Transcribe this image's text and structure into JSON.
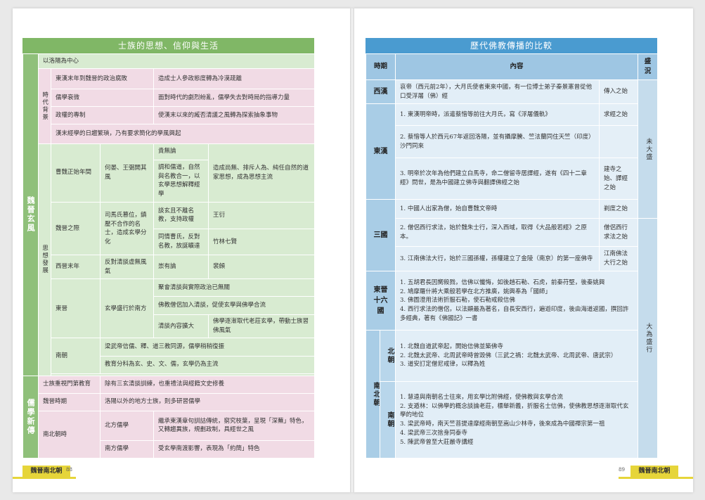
{
  "left": {
    "title": "士族的思想、信仰與生活",
    "side_a": "魏晉玄風",
    "side_b": "儒學新傳",
    "intro": "以洛陽為中心",
    "bg_label": "時代背景",
    "bg_rows": [
      {
        "k": "東漢末年到魏晉的政治腐敗",
        "v": "造成士人參政態度轉為冷漠疏離"
      },
      {
        "k": "儒學衰微",
        "v": "面對時代的劇烈紛亂，儒學失去對時局的指導力量"
      },
      {
        "k": "政權的專制",
        "v": "使漢末以來的臧否清議之風轉為探索抽象事物"
      }
    ],
    "bg_note": "漢末經學的日趨繁瑣，乃有要求簡化的學風興起",
    "dev_label": "思想發展",
    "caowei_period": "曹魏正始年間",
    "caowei_people": "何晏、王弼開其風",
    "caowei_a": "貴無論",
    "caowei_b": "調和儒道，自然與名教合一，以玄學思想解釋經學",
    "caowei_result": "造成尚無、排斥人為、純任自然的道家思想，成為思想主流",
    "weijin_period": "魏晉之際",
    "weijin_people": "司馬氏篡位，鎮壓不合作的名士，造成玄學分化",
    "weijin_a": "談玄且不離名教，支持政權",
    "weijin_a_who": "王衍",
    "weijin_b": "同情曹氏，反對名教，放誕曠達",
    "weijin_b_who": "竹林七賢",
    "xijin_period": "西晉末年",
    "xijin_people": "反對清談虛無風氣",
    "xijin_a": "崇有論",
    "xijin_a_who": "裴頠",
    "dongjin_period": "東晉",
    "dongjin_people": "玄學盛行於南方",
    "dongjin_a": "聚會清談與實際政治已無關",
    "dongjin_b": "佛教僧侶加入清談，促使玄學與佛學合流",
    "dongjin_c": "清談內容擴大",
    "dongjin_c_result": "佛學逐漸取代老莊玄學，帶動士族習佛風氣",
    "nanchao_period": "南朝",
    "nanchao_a": "梁武帝信儒、釋、道三教同源，儒學稍稍復振",
    "nanchao_b": "教育分科為玄、史、文、儒，玄學仍為主流",
    "rx_1k": "士族重視門第教育",
    "rx_1v": "除有三玄清談訓練，也重禮法與經籍文史修養",
    "rx_2k": "魏晉時期",
    "rx_2v": "洛陽以外的地方士族，則多研習儒學",
    "rx_3k": "南北朝時",
    "rx_3a": "北方儒學",
    "rx_3a_v": "繼承東漢章句訓詁傳統，窮究枝葉，呈現「深蕪」特色，又轉趨異族，規劃政制，具經世之風",
    "rx_3b": "南方儒學",
    "rx_3b_v": "受玄學南渡影響，表現為「約簡」特色"
  },
  "right": {
    "title": "歷代佛教傳播的比較",
    "head": {
      "period": "時期",
      "content": "內容",
      "status": "盛況"
    },
    "xihan": {
      "name": "西漢",
      "text": "哀帝（西元前2年），大月氏使者東來中國，有一位博士弟子秦景憲曾從他口受浮屠（佛）經",
      "note": "傳入之始"
    },
    "donghan": {
      "name": "東漢",
      "rows": [
        {
          "text": "1. 東漢明帝時，派遣蔡愔等前往大月氏，寫《浮屠儀軌》",
          "note": "求經之始"
        },
        {
          "text": "2. 蔡愔等人於西元67年返回洛陽，並有攝摩騰、竺法蘭同住天竺（印度）沙門同來",
          "note": ""
        },
        {
          "text": "3. 明帝於次年為他們建立白馬寺，命二僧留寺居譯經，遂有《四十二章經》問世，是為中國建立佛寺與翻譯佛經之始",
          "note": "建寺之始、譯經之始"
        }
      ]
    },
    "sanguo": {
      "name": "三國",
      "rows": [
        {
          "text": "1. 中國人出家為僧，始自曹魏文帝時",
          "note": "剃度之始"
        },
        {
          "text": "2. 僧侶西行求法，始於魏朱士行，深入西域，取得《大品般若經》之原本。",
          "note": "僧侶西行求法之始"
        },
        {
          "text": "3. 江南佛法大行，始於三國孫權，孫權建立了金陵（南京）的第一座佛寺",
          "note": "江南佛法大行之始"
        }
      ]
    },
    "dongjin": {
      "name_a": "東晉",
      "name_b": "十六國",
      "lines": [
        "1. 五胡君長因嚮殺戮，信佛以懺悔，如後趙石勒、石虎，前秦苻堅，後秦姚興",
        "2. 鳩摩羅什將大乘般若學在北方推廣，姚興奉為「國師」",
        "3. 佛圖澄用法術折服石勒，使石勒戒殺信佛",
        "4. 西行求法的僧侶，以法顯最為著名，自長安西行，遍遊印度，後由海道返國，撰回許多經典，著有《佛國記》一書"
      ]
    },
    "nanbei": {
      "name": "南北朝",
      "bei": "北朝",
      "bei_lines": [
        "1. 北魏自道武帝起，開始信佛並築佛寺",
        "2. 北魏太武帝、北周武帝時曾毀佛（三武之禍：北魏太武帝、北周武帝、唐武宗）",
        "3. 道安訂定僧尼戒律，以釋為姓"
      ],
      "nan": "南朝",
      "nan_lines": [
        "1. 慧遠與南朝名士往來，用玄學比附佛經，使佛教與玄學合流",
        "2. 支遁林：以佛學的概念談論老莊，標舉新義，折服名士信佛，使佛教思想逐漸取代玄學的地位",
        "3. 梁武帝時，南天竺菩提達摩經南朝至嵩山少林寺，後來成為中國禪宗第一祖",
        "4. 梁武帝三次捨身同泰寺",
        "5. 陳武帝曾至大莊嚴寺講經"
      ]
    },
    "status_a": "未大盛",
    "status_b": "大為盛行"
  },
  "footer": {
    "left_label": "魏晉南北朝",
    "left_page": "88",
    "right_label": "魏晉南北朝",
    "right_page": "89"
  }
}
